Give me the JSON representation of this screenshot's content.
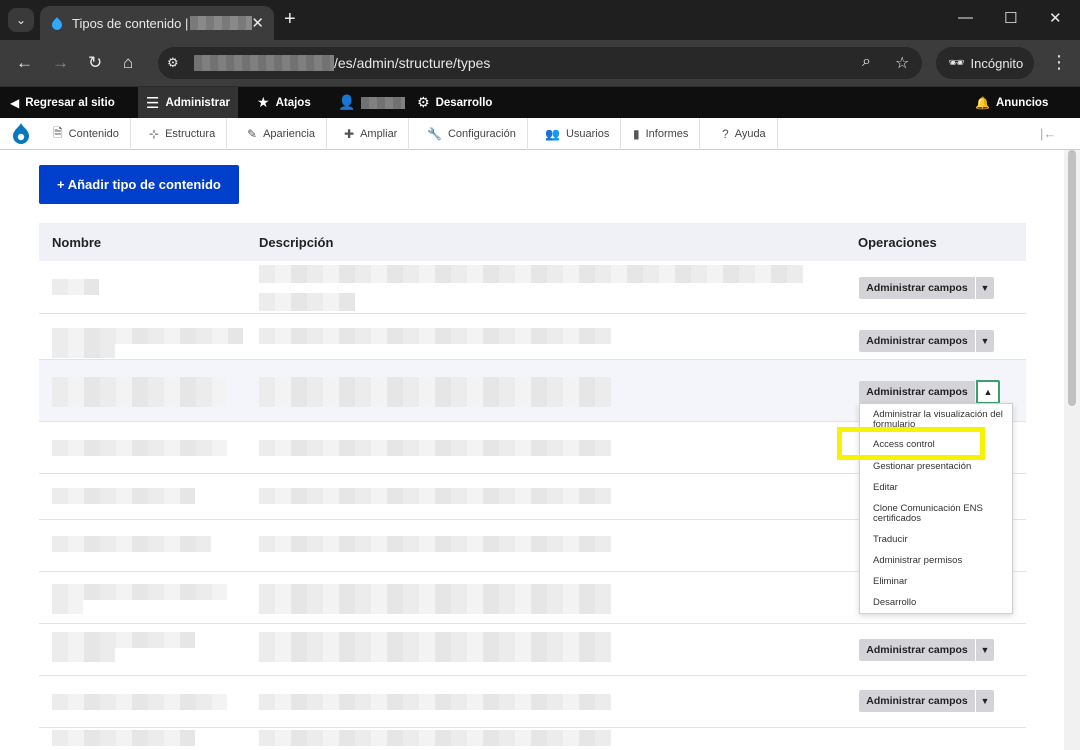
{
  "browser": {
    "tab_title": "Tipos de contenido |",
    "url": "/es/admin/structure/types",
    "incognito_label": "Incógnito"
  },
  "toolbar": {
    "back_to_site": "Regresar al sitio",
    "admin": "Administrar",
    "shortcuts": "Atajos",
    "devel": "Desarrollo",
    "announcements": "Anuncios"
  },
  "tray": {
    "items": [
      "Contenido",
      "Estructura",
      "Apariencia",
      "Ampliar",
      "Configuración",
      "Usuarios",
      "Informes",
      "Ayuda"
    ]
  },
  "page": {
    "add_button": "+ Añadir tipo de contenido",
    "columns": {
      "name": "Nombre",
      "description": "Descripción",
      "operations": "Operaciones"
    },
    "operation_button": "Administrar campos"
  },
  "dropdown": {
    "items": [
      "Administrar la visualización del formulario",
      "Access control",
      "Gestionar presentación",
      "Editar",
      "Clone Comunicación ENS certificados",
      "Traducir",
      "Administrar permisos",
      "Eliminar",
      "Desarrollo"
    ]
  },
  "colors": {
    "primary": "#003ecc",
    "highlight": "#f6f200",
    "focus": "#3aa06c"
  }
}
